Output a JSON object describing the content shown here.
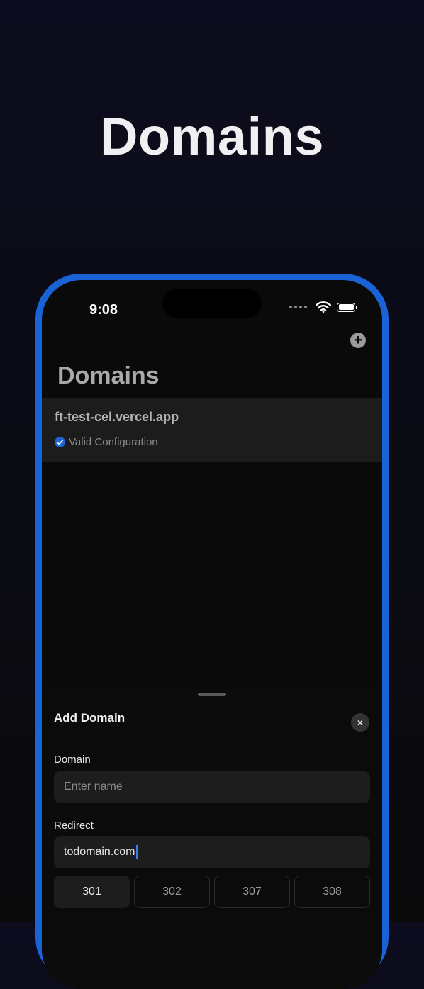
{
  "hero": {
    "title": "Domains"
  },
  "status_bar": {
    "time": "9:08"
  },
  "header": {
    "title": "Domains",
    "add_icon": "plus-circle-icon"
  },
  "domains": [
    {
      "name": "ft-test-cel.vercel.app",
      "status": "Valid Configuration",
      "status_icon": "checkmark-circle-icon"
    }
  ],
  "sheet": {
    "title": "Add Domain",
    "close_label": "×",
    "domain_field": {
      "label": "Domain",
      "placeholder": "Enter name",
      "value": ""
    },
    "redirect_field": {
      "label": "Redirect",
      "placeholder": "",
      "value": "todomain.com"
    },
    "redirect_codes": [
      {
        "label": "301",
        "selected": true
      },
      {
        "label": "302",
        "selected": false
      },
      {
        "label": "307",
        "selected": false
      },
      {
        "label": "308",
        "selected": false
      }
    ]
  },
  "colors": {
    "frame_accent": "#1a63d6",
    "check_blue": "#1e66d6",
    "caret_blue": "#3d7cf0"
  }
}
